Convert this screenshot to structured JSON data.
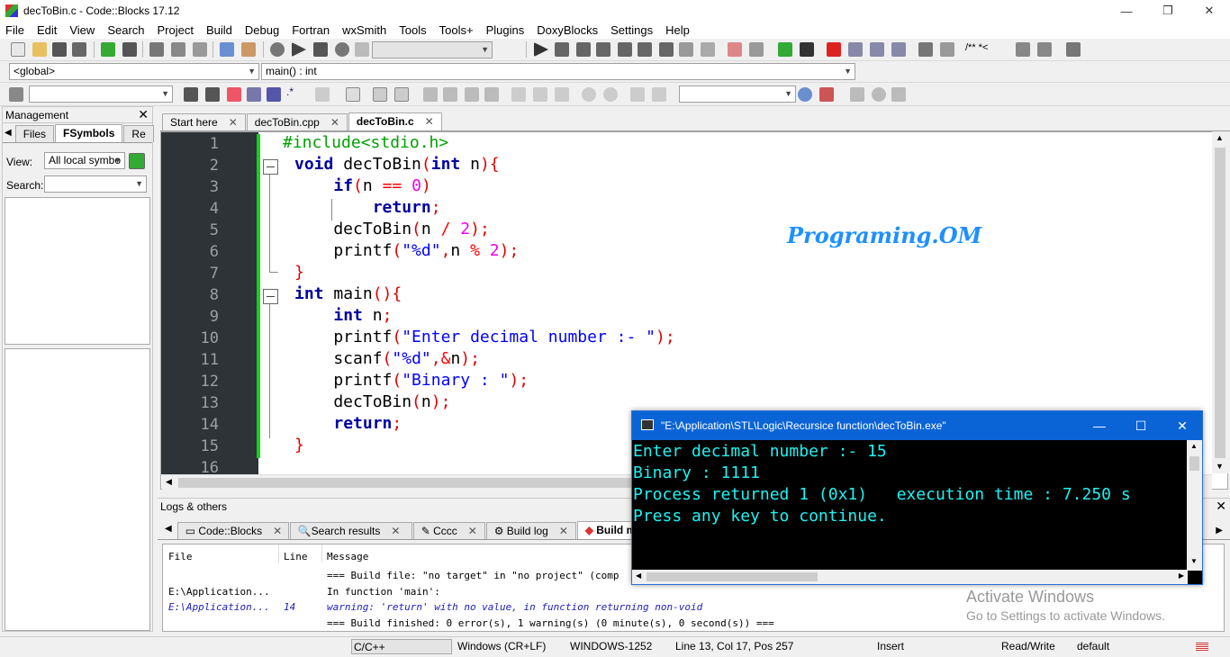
{
  "window": {
    "title": "decToBin.c - Code::Blocks 17.12",
    "min": "—",
    "restore": "❐",
    "close": "✕"
  },
  "menu": [
    "File",
    "Edit",
    "View",
    "Search",
    "Project",
    "Build",
    "Debug",
    "Fortran",
    "wxSmith",
    "Tools",
    "Tools+",
    "Plugins",
    "DoxyBlocks",
    "Settings",
    "Help"
  ],
  "scope": {
    "global": "<global>",
    "function": "main() : int"
  },
  "toolbar3": {
    "regex": ".*"
  },
  "management": {
    "title": "Management",
    "tabs": [
      "Files",
      "FSymbols",
      "Re"
    ],
    "view_label": "View:",
    "view_value": "All local symbo",
    "search_label": "Search:"
  },
  "editor_tabs": [
    {
      "label": "Start here",
      "active": false
    },
    {
      "label": "decToBin.cpp",
      "active": false
    },
    {
      "label": "decToBin.c",
      "active": true
    }
  ],
  "code_lines": [
    "#include<stdio.h>",
    "void decToBin(int n){",
    "    if(n == 0)",
    "        return;",
    "    decToBin(n / 2);",
    "    printf(\"%d\",n % 2);",
    "}",
    "int main(){",
    "    int n;",
    "    printf(\"Enter decimal number :- \");",
    "    scanf(\"%d\",&n);",
    "    printf(\"Binary : \");",
    "    decToBin(n);",
    "    return;",
    "}",
    ""
  ],
  "line_numbers": [
    "1",
    "2",
    "3",
    "4",
    "5",
    "6",
    "7",
    "8",
    "9",
    "10",
    "11",
    "12",
    "13",
    "14",
    "15",
    "16"
  ],
  "watermark": "Programing.OM",
  "logs": {
    "title": "Logs & others",
    "tabs": [
      "Code::Blocks",
      "Search results",
      "Cccc",
      "Build log",
      "Build m"
    ],
    "headers": {
      "file": "File",
      "line": "Line",
      "message": "Message"
    },
    "rows": [
      {
        "file": "",
        "line": "",
        "message": "=== Build file: \"no target\" in \"no project\" (comp"
      },
      {
        "file": "E:\\Application...",
        "line": "",
        "message": "In function 'main':"
      },
      {
        "file": "E:\\Application...",
        "line": "14",
        "message": "warning: 'return' with no value, in function returning non-void"
      },
      {
        "file": "",
        "line": "",
        "message": "=== Build finished: 0 error(s), 1 warning(s) (0 minute(s), 0 second(s)) ==="
      }
    ]
  },
  "console": {
    "title": "\"E:\\Application\\STL\\Logic\\Recursice function\\decToBin.exe\"",
    "lines": [
      "Enter decimal number :- 15",
      "Binary : 1111",
      "Process returned 1 (0x1)   execution time : 7.250 s",
      "Press any key to continue."
    ]
  },
  "activate": {
    "line1": "Activate Windows",
    "line2": "Go to Settings to activate Windows."
  },
  "status": {
    "lang": "C/C++",
    "eol": "Windows (CR+LF)",
    "enc": "WINDOWS-1252",
    "pos": "Line 13, Col 17, Pos 257",
    "mode": "Insert",
    "rw": "Read/Write",
    "profile": "default"
  },
  "colors": {
    "keyword": "#0000a0",
    "preproc": "#00a000",
    "string": "#0000ff",
    "number": "#f000f0",
    "operator": "#ff0000",
    "console_text": "#1ef2f2",
    "console_title": "#0a64d6",
    "watermark": "#1e90ff"
  }
}
